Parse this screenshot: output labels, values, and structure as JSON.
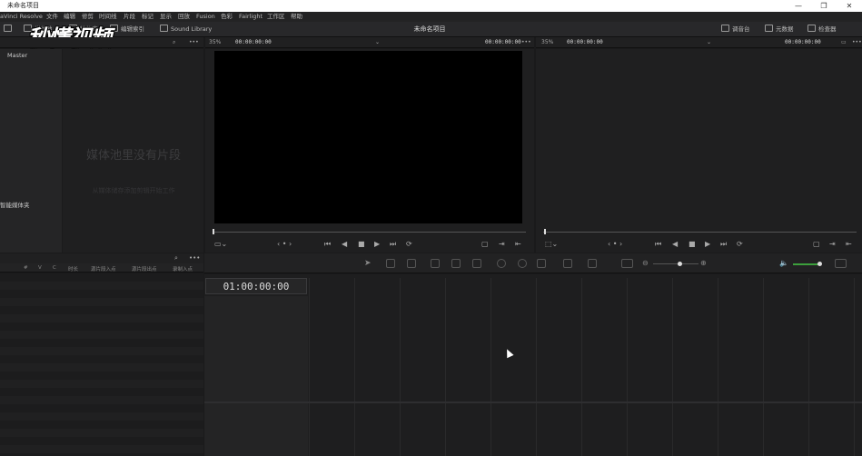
{
  "window": {
    "title": "未命名项目",
    "controls": [
      "—",
      "❐",
      "✕"
    ]
  },
  "menu": [
    "aVinci Resolve",
    "文件",
    "编辑",
    "修剪",
    "时间线",
    "片段",
    "标记",
    "显示",
    "回放",
    "Fusion",
    "色彩",
    "Fairlight",
    "工作区",
    "帮助"
  ],
  "toolbar": {
    "media_pool": "媒体池",
    "effects": "特效库",
    "edit_index": "编辑索引",
    "sound_library": "Sound Library",
    "project_title": "未命名项目",
    "mixer": "调音台",
    "metadata": "元数据",
    "inspector": "检查器"
  },
  "source_viewer": {
    "zoom": "35%",
    "timecode_left": "00:00:00:00",
    "timecode_right": "00:00:00:00"
  },
  "timeline_viewer": {
    "zoom": "35%",
    "timecode_left": "00:00:00:00",
    "timecode_right": "00:00:00:00"
  },
  "media_pool": {
    "bin": "Master",
    "smart_bins": "智能媒体夹",
    "empty_title": "媒体池里没有片段",
    "empty_hint": "从媒体储存添加剪辑开始工作",
    "columns": [
      "#",
      "V",
      "C",
      "时长",
      "源片段入点",
      "源片段出点",
      "录制入点"
    ]
  },
  "timeline": {
    "timecode": "01:00:00:00"
  },
  "watermark": "秒懂视频"
}
